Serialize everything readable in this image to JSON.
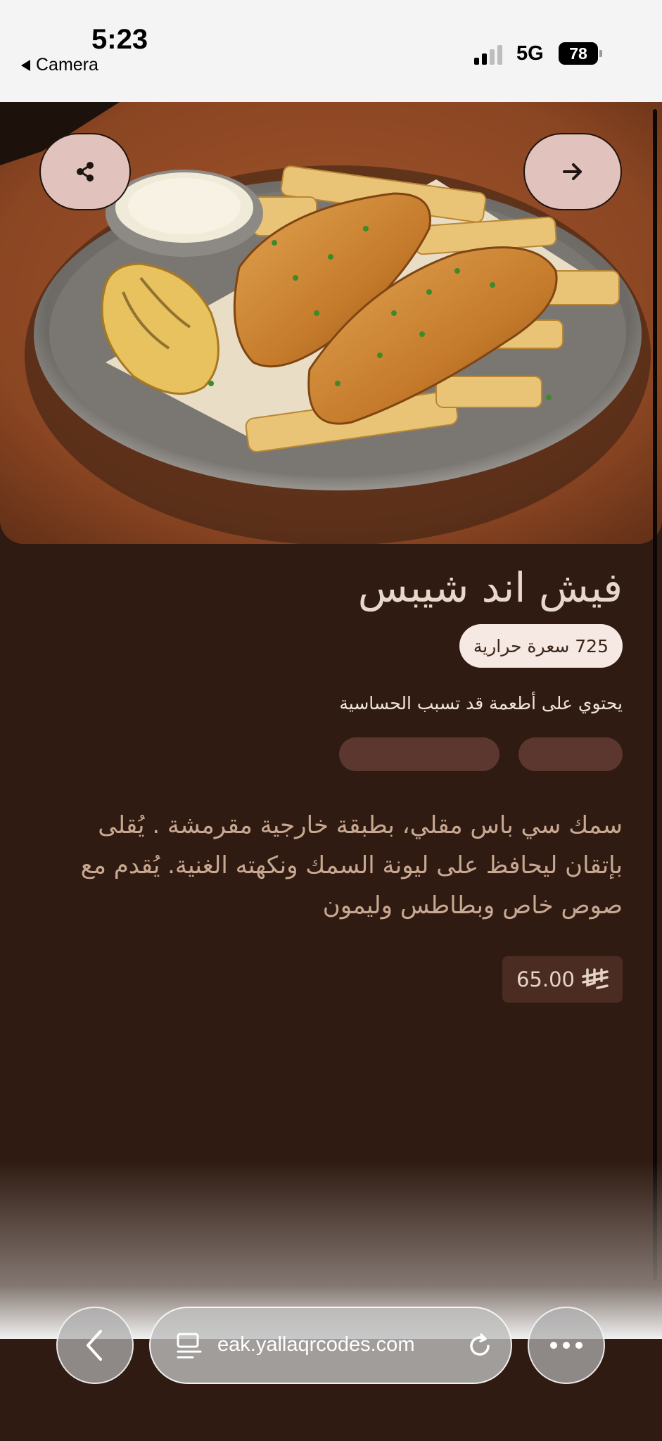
{
  "status_bar": {
    "time": "5:23",
    "back_app": "Camera",
    "network": "5G",
    "battery": "78"
  },
  "item": {
    "name": "فيش اند شيبس",
    "calories": "725 سعرة حرارية",
    "allergen_label": "يحتوي على أطعمة قد تسبب الحساسية",
    "description": "سمك سي باس مقلي، بطبقة خارجية مقرمشة . يُقلى بإتقان ليحافظ على ليونة السمك ونكهته الغنية. يُقدم مع صوص  خاص وبطاطس وليمون",
    "price": "65.00"
  },
  "browser": {
    "url": "eak.yallaqrcodes.com"
  },
  "icons": {
    "share": "share-icon",
    "next": "arrow-right-icon",
    "currency": "riyal-icon",
    "back": "chevron-left-icon",
    "reader": "reader-mode-icon",
    "reload": "reload-icon",
    "more": "more-icon"
  },
  "colors": {
    "background": "#2f1b12",
    "button": "#e1c2bd",
    "badge": "#f6e9e4",
    "pill": "#5c372f",
    "price_bg": "#4b2c22"
  }
}
